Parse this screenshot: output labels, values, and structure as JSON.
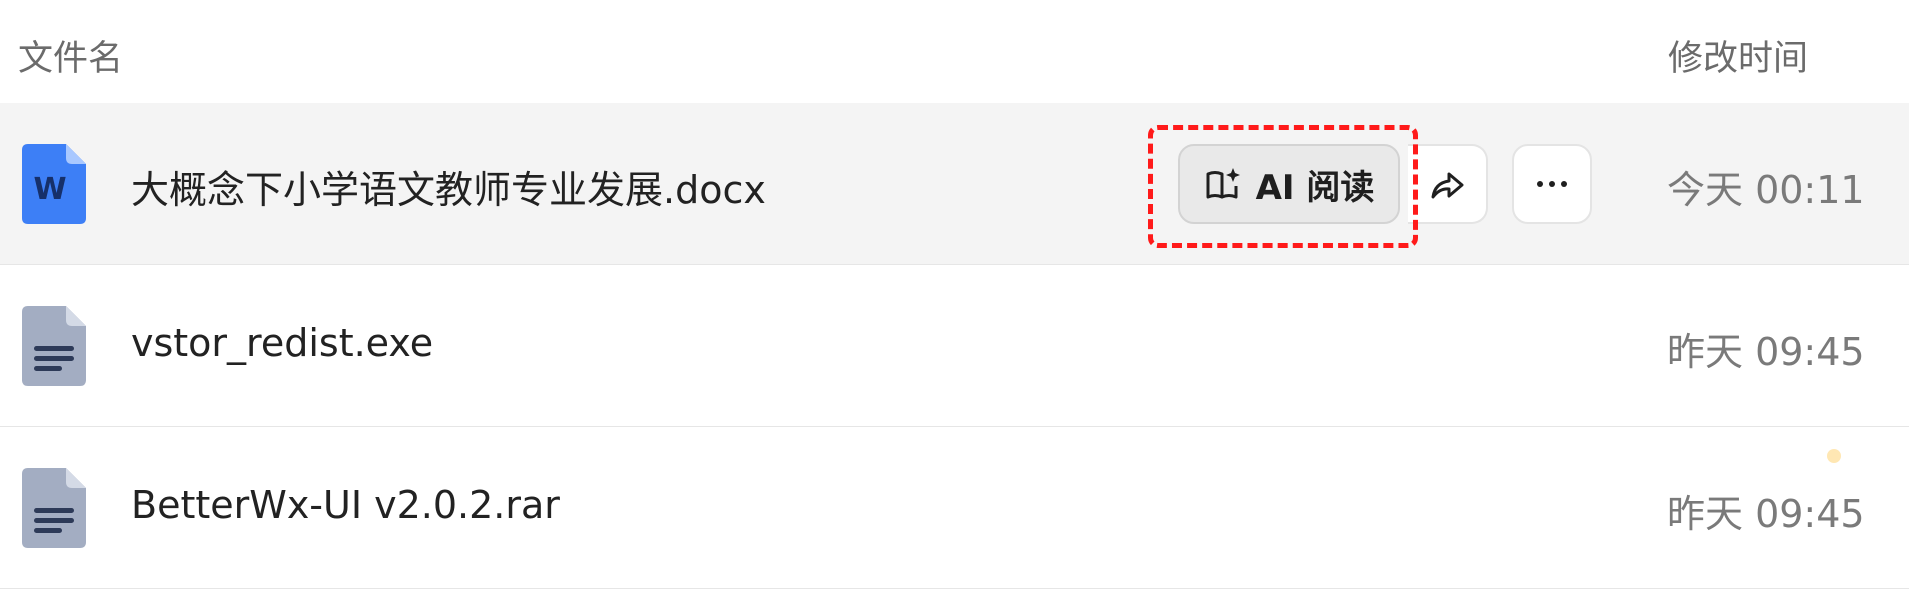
{
  "columns": {
    "name": "文件名",
    "modified": "修改时间"
  },
  "files": [
    {
      "name": "大概念下小学语文教师专业发展.docx",
      "modified": "今天 00:11",
      "icon": "word-doc-icon",
      "icon_letter": "W",
      "selected": true
    },
    {
      "name": "vstor_redist.exe",
      "modified": "昨天 09:45",
      "icon": "generic-file-icon",
      "selected": false
    },
    {
      "name": "BetterWx-UI v2.0.2.rar",
      "modified": "昨天 09:45",
      "icon": "generic-file-icon",
      "selected": false
    }
  ],
  "row_actions": {
    "ai_read_label": "AI 阅读",
    "ai_read_icon": "ai-book-icon",
    "share_icon": "share-icon",
    "more_icon": "more-icon"
  },
  "colors": {
    "word_blue": "#3d7ff6",
    "highlight": "#ff1a1a",
    "selected_row_bg": "#f4f4f4",
    "generic_icon": "#a3adc2"
  }
}
